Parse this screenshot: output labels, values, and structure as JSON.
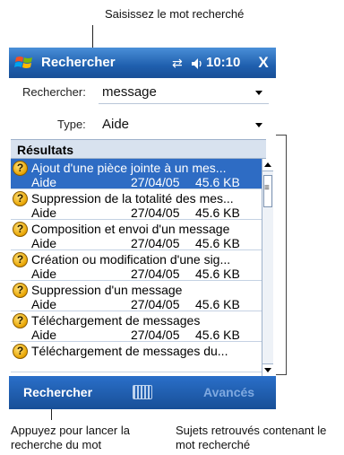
{
  "captions": {
    "top": "Saisissez le mot recherché",
    "bottom_left": [
      "Appuyez pour lancer la",
      "recherche du mot"
    ],
    "bottom_right": [
      "Sujets retrouvés contenant le",
      "mot recherché"
    ]
  },
  "titlebar": {
    "title": "Rechercher",
    "time": "10:10",
    "close": "X"
  },
  "search": {
    "label": "Rechercher:",
    "value": "message"
  },
  "type": {
    "label": "Type:",
    "value": "Aide"
  },
  "results": {
    "header": "Résultats",
    "items": [
      {
        "title": "Ajout d'une pièce jointe à un mes...",
        "type": "Aide",
        "date": "27/04/05",
        "size": "45.6 KB",
        "selected": true
      },
      {
        "title": "Suppression de la totalité des mes...",
        "type": "Aide",
        "date": "27/04/05",
        "size": "45.6 KB"
      },
      {
        "title": "Composition et envoi d'un message",
        "type": "Aide",
        "date": "27/04/05",
        "size": "45.6 KB"
      },
      {
        "title": "Création ou modification d'une sig...",
        "type": "Aide",
        "date": "27/04/05",
        "size": "45.6 KB"
      },
      {
        "title": "Suppression d'un message",
        "type": "Aide",
        "date": "27/04/05",
        "size": "45.6 KB"
      },
      {
        "title": "Téléchargement de messages",
        "type": "Aide",
        "date": "27/04/05",
        "size": "45.6 KB"
      },
      {
        "title": "Téléchargement de messages du...",
        "type": "",
        "date": "",
        "size": ""
      }
    ]
  },
  "menubar": {
    "left": "Rechercher",
    "right": "Avancés"
  },
  "icons": {
    "start": "windows-flag-icon",
    "connectivity": "connection-arrows-icon",
    "volume": "speaker-icon",
    "help": "question-mark-icon",
    "keyboard": "keyboard-icon"
  },
  "colors": {
    "titlebar": "#1f5fae",
    "selection": "#2e6cc4",
    "header_bg": "#d8e2ef",
    "menubar": "#184f97"
  }
}
